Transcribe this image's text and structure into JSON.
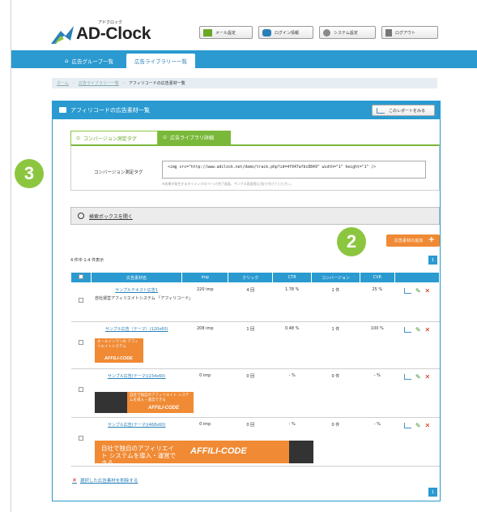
{
  "header": {
    "logo_kana": "アドクロック",
    "logo_text": "AD-Clock",
    "buttons": [
      {
        "label": "メール設定",
        "icon": "mail-icon"
      },
      {
        "label": "ログイン情報",
        "icon": "user-group-icon"
      },
      {
        "label": "システム設定",
        "icon": "gear-icon"
      },
      {
        "label": "ログアウト",
        "icon": "door-icon"
      }
    ]
  },
  "nav": {
    "tabs": [
      {
        "label": "広告グループ一覧",
        "icon": "home-icon"
      },
      {
        "label": "広告ライブラリー一覧"
      }
    ]
  },
  "breadcrumb": [
    "ホーム",
    "広告ライブラリー一覧",
    "アフィリコードの広告素材一覧"
  ],
  "panel": {
    "title": "アフィリコードの広告素材一覧",
    "report_button": "このレポートをみる",
    "subtabs": [
      "コンバージョン測定タグ",
      "広告ライブラリ詳細"
    ],
    "tag_label": "コンバージョン測定タグ",
    "tag_value": "<img src=\"http://www.adclock.net/demo/track.php?id=4f947afbc8849\" width=\"1\" height=\"1\" />",
    "tag_note": "※成果が発生するタイミングのページ(完了画面、サンクス画面等)に貼り付けてください。",
    "search_label": "検索ボックスを開く",
    "add_button": "広告素材の追加",
    "count_text": "4 件中 1-4 件表示",
    "page": "1",
    "delete_link": "選択した広告素材を削除する"
  },
  "table": {
    "headers": [
      "広告素材名",
      "imp",
      "クリック",
      "CTR",
      "コンバージョン",
      "CVR"
    ],
    "rows": [
      {
        "name": "サンプルテキスト広告1",
        "imp": "220 imp",
        "click": "4 回",
        "ctr": "1.78 %",
        "cv": "1 件",
        "cvr": "25 %",
        "extra": "自社運営アフィリエイトシステム 「アフィリコード」"
      },
      {
        "name": "サンプル広告（テーマ）(120x60)",
        "imp": "208 imp",
        "click": "1 回",
        "ctr": "0.48 %",
        "cv": "1 件",
        "cvr": "100 %",
        "banner": "オールインワンの アフィリエイトシステム",
        "brand": "AFFILI-CODE"
      },
      {
        "name": "サンプル広告(テーマ)(234x60)",
        "imp": "0 imp",
        "click": "0 回",
        "ctr": "- %",
        "cv": "0 件",
        "cvr": "- %",
        "banner": "自社で独自のアフィリエイト システムを導入・運営できる",
        "brand": "AFFILI-CODE"
      },
      {
        "name": "サンプル広告(テーマ)(468x60)",
        "imp": "0 imp",
        "click": "0 回",
        "ctr": "- %",
        "cv": "0 件",
        "cvr": "- %",
        "banner": "自社で独自のアフィリエイト システムを導入・運営できる",
        "brand": "AFFILI-CODE"
      }
    ]
  },
  "badges": [
    "3",
    "2"
  ],
  "colors": {
    "accent": "#2a9ad0",
    "green": "#8cc63f",
    "orange": "#f08a34"
  }
}
